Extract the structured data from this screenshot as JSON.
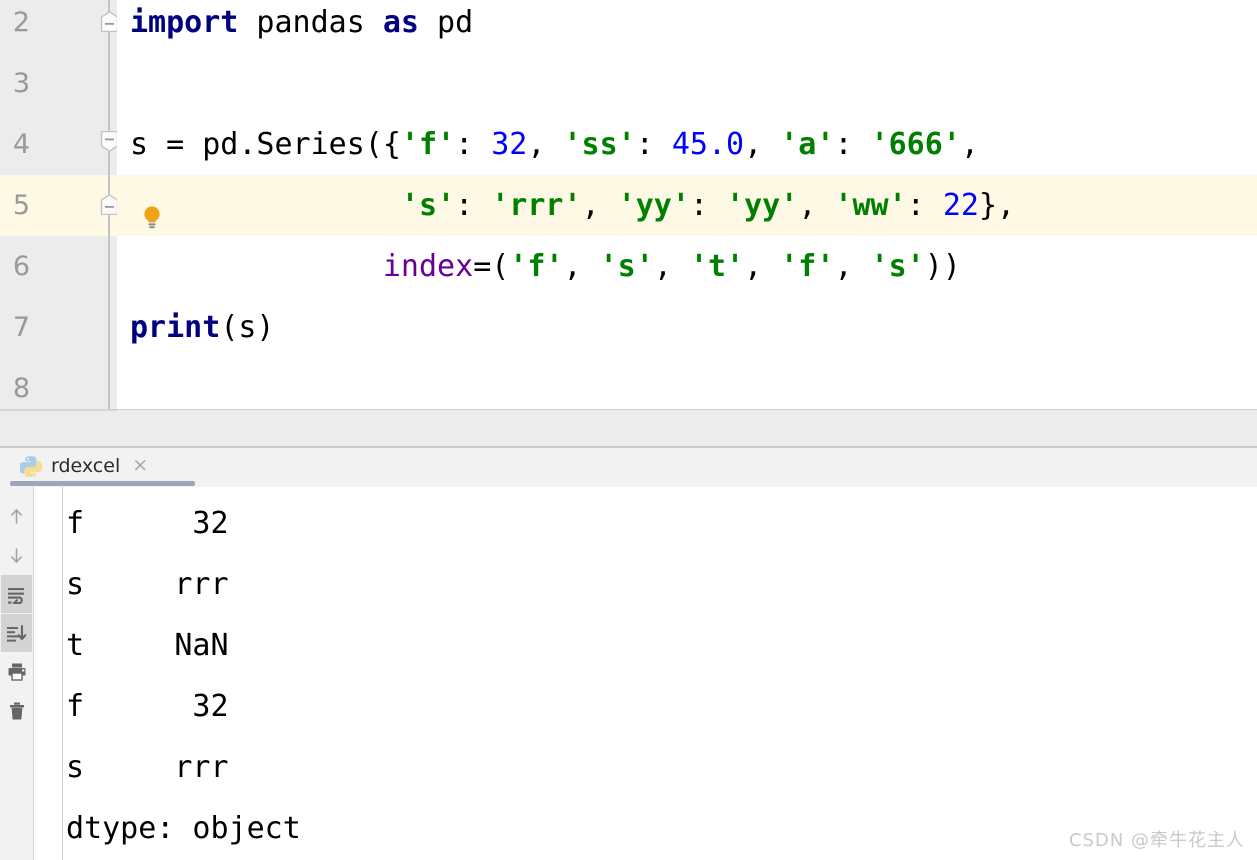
{
  "editor": {
    "lines": [
      {
        "number": "2",
        "highlight": false,
        "fold": "start",
        "has_bulb": false,
        "tokens": [
          {
            "text": "import",
            "style": "kw"
          },
          {
            "text": " pandas ",
            "style": "plain"
          },
          {
            "text": "as",
            "style": "kw"
          },
          {
            "text": " pd",
            "style": "plain"
          }
        ],
        "plain_text": "import pandas as pd"
      },
      {
        "number": "3",
        "highlight": false,
        "fold": "line",
        "has_bulb": false,
        "tokens": [],
        "plain_text": ""
      },
      {
        "number": "4",
        "highlight": false,
        "fold": "end",
        "has_bulb": false,
        "tokens": [
          {
            "text": "s = pd.Series({",
            "style": "plain"
          },
          {
            "text": "'f'",
            "style": "str"
          },
          {
            "text": ": ",
            "style": "plain"
          },
          {
            "text": "32",
            "style": "num"
          },
          {
            "text": ", ",
            "style": "plain"
          },
          {
            "text": "'ss'",
            "style": "str"
          },
          {
            "text": ": ",
            "style": "plain"
          },
          {
            "text": "45.0",
            "style": "num"
          },
          {
            "text": ", ",
            "style": "plain"
          },
          {
            "text": "'a'",
            "style": "str"
          },
          {
            "text": ": ",
            "style": "plain"
          },
          {
            "text": "'666'",
            "style": "str"
          },
          {
            "text": ",",
            "style": "plain"
          }
        ],
        "plain_text": "s = pd.Series({'f': 32, 'ss': 45.0, 'a': '666',"
      },
      {
        "number": "5",
        "highlight": true,
        "fold": "start",
        "has_bulb": true,
        "tokens": [
          {
            "text": "               ",
            "style": "plain"
          },
          {
            "text": "'s'",
            "style": "str"
          },
          {
            "text": ": ",
            "style": "plain"
          },
          {
            "text": "'rrr'",
            "style": "str"
          },
          {
            "text": ", ",
            "style": "plain"
          },
          {
            "text": "'yy'",
            "style": "str"
          },
          {
            "text": ": ",
            "style": "plain"
          },
          {
            "text": "'yy'",
            "style": "str"
          },
          {
            "text": ", ",
            "style": "plain"
          },
          {
            "text": "'ww'",
            "style": "str"
          },
          {
            "text": ": ",
            "style": "plain"
          },
          {
            "text": "22",
            "style": "num"
          },
          {
            "text": "},",
            "style": "plain"
          }
        ],
        "plain_text": "               's': 'rrr', 'yy': 'yy', 'ww': 22},"
      },
      {
        "number": "6",
        "highlight": false,
        "fold": "line",
        "has_bulb": false,
        "tokens": [
          {
            "text": "              ",
            "style": "plain"
          },
          {
            "text": "index",
            "style": "kwarg"
          },
          {
            "text": "=(",
            "style": "plain"
          },
          {
            "text": "'f'",
            "style": "str"
          },
          {
            "text": ", ",
            "style": "plain"
          },
          {
            "text": "'s'",
            "style": "str"
          },
          {
            "text": ", ",
            "style": "plain"
          },
          {
            "text": "'t'",
            "style": "str"
          },
          {
            "text": ", ",
            "style": "plain"
          },
          {
            "text": "'f'",
            "style": "str"
          },
          {
            "text": ", ",
            "style": "plain"
          },
          {
            "text": "'s'",
            "style": "str"
          },
          {
            "text": "))",
            "style": "plain"
          }
        ],
        "plain_text": "              index=('f', 's', 't', 'f', 's'))"
      },
      {
        "number": "7",
        "highlight": false,
        "fold": "line",
        "has_bulb": false,
        "tokens": [
          {
            "text": "print",
            "style": "kwfn"
          },
          {
            "text": "(s)",
            "style": "plain"
          }
        ],
        "plain_text": "print(s)"
      },
      {
        "number": "8",
        "highlight": false,
        "fold": "line",
        "has_bulb": false,
        "tokens": [],
        "plain_text": ""
      }
    ]
  },
  "console_tabs": {
    "tabs": [
      {
        "label": "rdexcel",
        "icon": "python-icon",
        "close": "×",
        "active": true
      }
    ]
  },
  "console_toolbar": {
    "buttons": [
      {
        "name": "up-arrow-icon",
        "label": "Up",
        "active": false
      },
      {
        "name": "down-arrow-icon",
        "label": "Down",
        "active": false
      },
      {
        "name": "soft-wrap-icon",
        "label": "Soft-Wrap",
        "active": true
      },
      {
        "name": "scroll-to-end-icon",
        "label": "Scroll to End",
        "active": true
      },
      {
        "name": "print-icon",
        "label": "Print",
        "active": false
      },
      {
        "name": "trash-icon",
        "label": "Clear All",
        "active": false
      }
    ]
  },
  "console_output": {
    "lines": [
      "f      32",
      "s     rrr",
      "t     NaN",
      "f      32",
      "s     rrr",
      "dtype: object"
    ]
  },
  "watermark": {
    "text": "CSDN @牵牛花主人"
  },
  "colors": {
    "keyword": "#000080",
    "string": "#008000",
    "number": "#0000ff",
    "kwarg": "#660099",
    "highlight_line": "#fdf9e4",
    "gutter": "#ececec",
    "tab_underline": "#9aa7bb"
  }
}
